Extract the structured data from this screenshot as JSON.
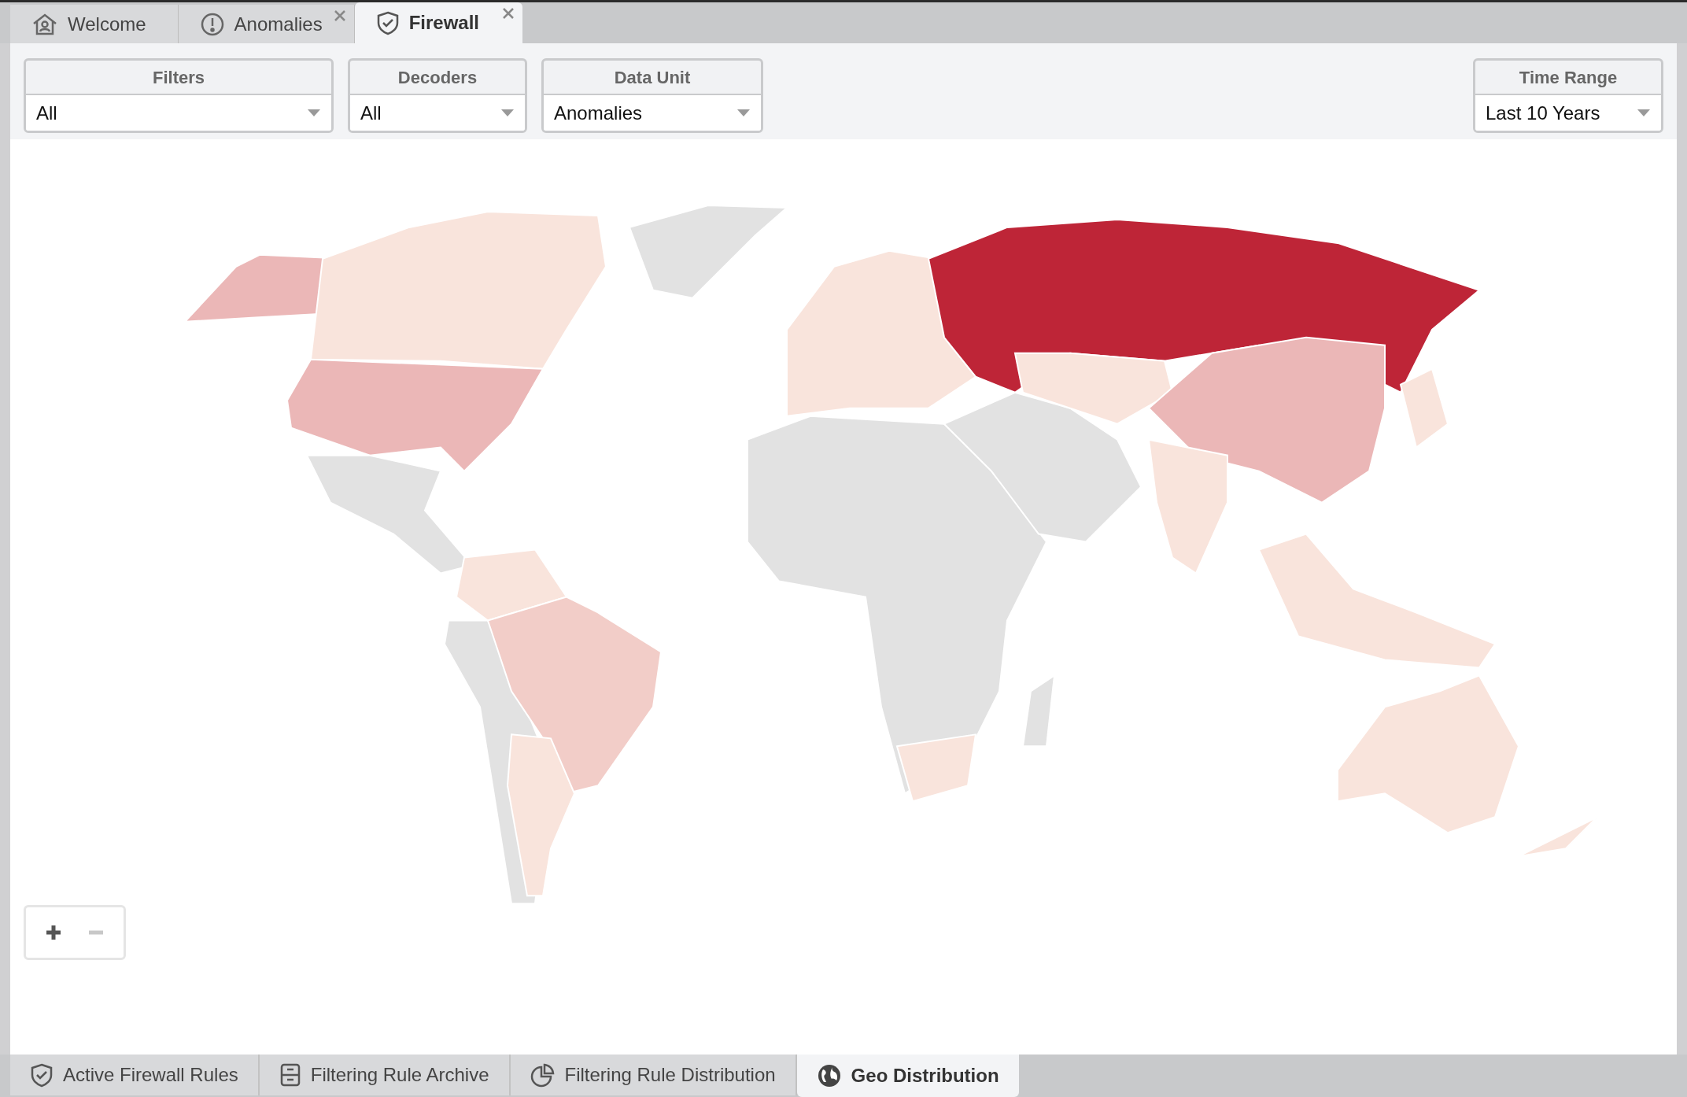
{
  "top_tabs": [
    {
      "label": "Welcome",
      "closable": false,
      "selected": false
    },
    {
      "label": "Anomalies",
      "closable": true,
      "selected": false
    },
    {
      "label": "Firewall",
      "closable": true,
      "selected": true
    }
  ],
  "controls": [
    {
      "label": "Filters",
      "value": "All"
    },
    {
      "label": "Decoders",
      "value": "All"
    },
    {
      "label": "Data Unit",
      "value": "Anomalies"
    }
  ],
  "time_range": {
    "label": "Time Range",
    "value": "Last 10 Years"
  },
  "bottom_tabs": [
    {
      "label": "Active Firewall Rules",
      "selected": false
    },
    {
      "label": "Filtering Rule Archive",
      "selected": false
    },
    {
      "label": "Filtering Rule Distribution",
      "selected": false
    },
    {
      "label": "Geo Distribution",
      "selected": true
    }
  ]
}
